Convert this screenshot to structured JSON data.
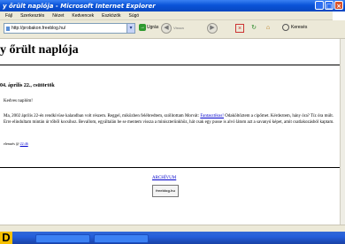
{
  "window": {
    "title": "egy őrült naplója - Microsoft Internet Explorer",
    "title_visible": "y őrült naplója - Microsoft Internet Explorer",
    "controls": [
      "_",
      "□",
      "×"
    ]
  },
  "menu": [
    "Fájl",
    "Szerkesztés",
    "Nézet",
    "Kedvencek",
    "Eszközök",
    "Súgó"
  ],
  "toolbar": {
    "address": "http://probakon.freeblog.hu/",
    "go_label": "Ugrás",
    "back_label": "Vissza",
    "search_label": "Keresés"
  },
  "page": {
    "blog_title": "y őrült naplója",
    "date": "04. április 22., csütörtök",
    "greeting": "Kedves naplóm!",
    "body_text": "Ma, 2002 április 22-én rendkívüse kalandban volt részem. Reggel, miközben felébredtem, szólítottam Morvát:",
    "body_link": "Fantasztikus!",
    "body_text2": "Odaköltöztem a cipőmet. Kérdeztem, hány óra? Tíz óra múlt. Erre elindultam mintán úr tőből kocsihoz. Bevallom, egyáltalán be se mentem vissza a miniszterünkhöz, hát csak egy pusse is alvó látom azt a savanyú képet, amit csatlakozásból kaptam.",
    "footer_text": "elemzés @",
    "footer_link": "22:46",
    "archive_link": "ARCHÍVUM",
    "badge": "freeblog.hu"
  },
  "label": "D"
}
